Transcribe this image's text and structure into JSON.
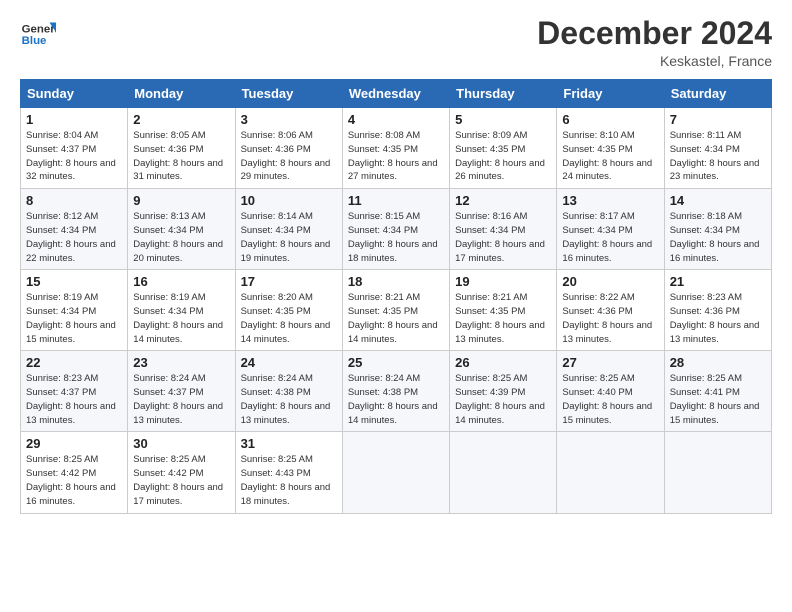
{
  "logo": {
    "line1": "General",
    "line2": "Blue"
  },
  "title": "December 2024",
  "location": "Keskastel, France",
  "headers": [
    "Sunday",
    "Monday",
    "Tuesday",
    "Wednesday",
    "Thursday",
    "Friday",
    "Saturday"
  ],
  "weeks": [
    [
      {
        "day": "1",
        "sunrise": "Sunrise: 8:04 AM",
        "sunset": "Sunset: 4:37 PM",
        "daylight": "Daylight: 8 hours and 32 minutes."
      },
      {
        "day": "2",
        "sunrise": "Sunrise: 8:05 AM",
        "sunset": "Sunset: 4:36 PM",
        "daylight": "Daylight: 8 hours and 31 minutes."
      },
      {
        "day": "3",
        "sunrise": "Sunrise: 8:06 AM",
        "sunset": "Sunset: 4:36 PM",
        "daylight": "Daylight: 8 hours and 29 minutes."
      },
      {
        "day": "4",
        "sunrise": "Sunrise: 8:08 AM",
        "sunset": "Sunset: 4:35 PM",
        "daylight": "Daylight: 8 hours and 27 minutes."
      },
      {
        "day": "5",
        "sunrise": "Sunrise: 8:09 AM",
        "sunset": "Sunset: 4:35 PM",
        "daylight": "Daylight: 8 hours and 26 minutes."
      },
      {
        "day": "6",
        "sunrise": "Sunrise: 8:10 AM",
        "sunset": "Sunset: 4:35 PM",
        "daylight": "Daylight: 8 hours and 24 minutes."
      },
      {
        "day": "7",
        "sunrise": "Sunrise: 8:11 AM",
        "sunset": "Sunset: 4:34 PM",
        "daylight": "Daylight: 8 hours and 23 minutes."
      }
    ],
    [
      {
        "day": "8",
        "sunrise": "Sunrise: 8:12 AM",
        "sunset": "Sunset: 4:34 PM",
        "daylight": "Daylight: 8 hours and 22 minutes."
      },
      {
        "day": "9",
        "sunrise": "Sunrise: 8:13 AM",
        "sunset": "Sunset: 4:34 PM",
        "daylight": "Daylight: 8 hours and 20 minutes."
      },
      {
        "day": "10",
        "sunrise": "Sunrise: 8:14 AM",
        "sunset": "Sunset: 4:34 PM",
        "daylight": "Daylight: 8 hours and 19 minutes."
      },
      {
        "day": "11",
        "sunrise": "Sunrise: 8:15 AM",
        "sunset": "Sunset: 4:34 PM",
        "daylight": "Daylight: 8 hours and 18 minutes."
      },
      {
        "day": "12",
        "sunrise": "Sunrise: 8:16 AM",
        "sunset": "Sunset: 4:34 PM",
        "daylight": "Daylight: 8 hours and 17 minutes."
      },
      {
        "day": "13",
        "sunrise": "Sunrise: 8:17 AM",
        "sunset": "Sunset: 4:34 PM",
        "daylight": "Daylight: 8 hours and 16 minutes."
      },
      {
        "day": "14",
        "sunrise": "Sunrise: 8:18 AM",
        "sunset": "Sunset: 4:34 PM",
        "daylight": "Daylight: 8 hours and 16 minutes."
      }
    ],
    [
      {
        "day": "15",
        "sunrise": "Sunrise: 8:19 AM",
        "sunset": "Sunset: 4:34 PM",
        "daylight": "Daylight: 8 hours and 15 minutes."
      },
      {
        "day": "16",
        "sunrise": "Sunrise: 8:19 AM",
        "sunset": "Sunset: 4:34 PM",
        "daylight": "Daylight: 8 hours and 14 minutes."
      },
      {
        "day": "17",
        "sunrise": "Sunrise: 8:20 AM",
        "sunset": "Sunset: 4:35 PM",
        "daylight": "Daylight: 8 hours and 14 minutes."
      },
      {
        "day": "18",
        "sunrise": "Sunrise: 8:21 AM",
        "sunset": "Sunset: 4:35 PM",
        "daylight": "Daylight: 8 hours and 14 minutes."
      },
      {
        "day": "19",
        "sunrise": "Sunrise: 8:21 AM",
        "sunset": "Sunset: 4:35 PM",
        "daylight": "Daylight: 8 hours and 13 minutes."
      },
      {
        "day": "20",
        "sunrise": "Sunrise: 8:22 AM",
        "sunset": "Sunset: 4:36 PM",
        "daylight": "Daylight: 8 hours and 13 minutes."
      },
      {
        "day": "21",
        "sunrise": "Sunrise: 8:23 AM",
        "sunset": "Sunset: 4:36 PM",
        "daylight": "Daylight: 8 hours and 13 minutes."
      }
    ],
    [
      {
        "day": "22",
        "sunrise": "Sunrise: 8:23 AM",
        "sunset": "Sunset: 4:37 PM",
        "daylight": "Daylight: 8 hours and 13 minutes."
      },
      {
        "day": "23",
        "sunrise": "Sunrise: 8:24 AM",
        "sunset": "Sunset: 4:37 PM",
        "daylight": "Daylight: 8 hours and 13 minutes."
      },
      {
        "day": "24",
        "sunrise": "Sunrise: 8:24 AM",
        "sunset": "Sunset: 4:38 PM",
        "daylight": "Daylight: 8 hours and 13 minutes."
      },
      {
        "day": "25",
        "sunrise": "Sunrise: 8:24 AM",
        "sunset": "Sunset: 4:38 PM",
        "daylight": "Daylight: 8 hours and 14 minutes."
      },
      {
        "day": "26",
        "sunrise": "Sunrise: 8:25 AM",
        "sunset": "Sunset: 4:39 PM",
        "daylight": "Daylight: 8 hours and 14 minutes."
      },
      {
        "day": "27",
        "sunrise": "Sunrise: 8:25 AM",
        "sunset": "Sunset: 4:40 PM",
        "daylight": "Daylight: 8 hours and 15 minutes."
      },
      {
        "day": "28",
        "sunrise": "Sunrise: 8:25 AM",
        "sunset": "Sunset: 4:41 PM",
        "daylight": "Daylight: 8 hours and 15 minutes."
      }
    ],
    [
      {
        "day": "29",
        "sunrise": "Sunrise: 8:25 AM",
        "sunset": "Sunset: 4:42 PM",
        "daylight": "Daylight: 8 hours and 16 minutes."
      },
      {
        "day": "30",
        "sunrise": "Sunrise: 8:25 AM",
        "sunset": "Sunset: 4:42 PM",
        "daylight": "Daylight: 8 hours and 17 minutes."
      },
      {
        "day": "31",
        "sunrise": "Sunrise: 8:25 AM",
        "sunset": "Sunset: 4:43 PM",
        "daylight": "Daylight: 8 hours and 18 minutes."
      },
      null,
      null,
      null,
      null
    ]
  ]
}
